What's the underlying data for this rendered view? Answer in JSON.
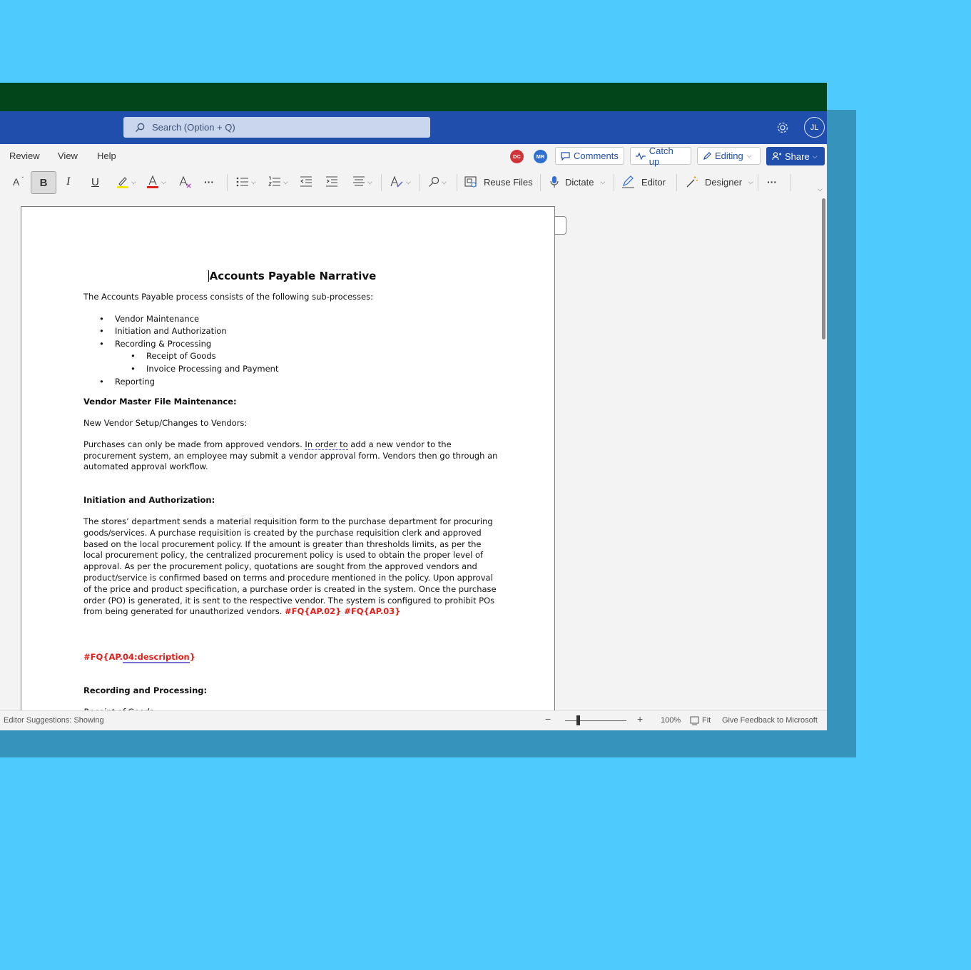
{
  "app": {
    "search_placeholder": "Search (Option + Q)",
    "user_initials": "JL"
  },
  "tabs": {
    "review": "Review",
    "view": "View",
    "help": "Help"
  },
  "presence": [
    {
      "initials": "DC",
      "color": "#d13438"
    },
    {
      "initials": "MR",
      "color": "#2f6fd1"
    }
  ],
  "ribbon_buttons": {
    "comments": "Comments",
    "catch_up": "Catch up",
    "editing": "Editing",
    "share": "Share"
  },
  "toolbar": {
    "font_size_icon": "A",
    "bold": "B",
    "italic": "I",
    "underline": "U",
    "more": "···",
    "reuse_files": "Reuse Files",
    "dictate": "Dictate",
    "editor": "Editor",
    "designer": "Designer"
  },
  "document": {
    "title": "Accounts Payable Narrative",
    "intro": "The Accounts Payable process consists of the following sub-processes:",
    "bullets": [
      "Vendor Maintenance",
      "Initiation and Authorization",
      "Recording & Processing"
    ],
    "sub_bullets": [
      "Receipt of Goods",
      "Invoice Processing and Payment"
    ],
    "last_bullet": "Reporting",
    "h_vendor": "Vendor Master File Maintenance:",
    "p_new_vendor": "New Vendor Setup/Changes to Vendors:",
    "p_purchases_a": "Purchases can only be made from approved vendors. ",
    "p_purchases_dashed": "In order to",
    "p_purchases_b": " add a new vendor to the procurement system, an employee may submit a vendor approval form. Vendors then go through an automated approval workflow.",
    "h_initiation": "Initiation and Authorization:",
    "p_stores": "The stores’ department sends a material requisition form to the purchase department for procuring goods/services.  A purchase requisition is created by the purchase requisition clerk and approved based on the local procurement policy.  If the amount is greater than thresholds limits, as per the local procurement policy, the centralized procurement policy is used to obtain the proper level of approval. As per the procurement policy, quotations are sought from the approved vendors and product/service is confirmed based on terms and procedure mentioned in the policy. Upon approval of the price and product specification, a purchase order is created in the system.  Once the purchase order (PO) is generated, it is sent to the respective vendor.  The system is configured to prohibit POs from being generated for unauthorized vendors.  ",
    "p_stores_tags": "#FQ{AP.02} #FQ{AP.03}",
    "tag_a": "#FQ{AP.",
    "tag_b": "04:description",
    "tag_c": "}",
    "h_recording": "Recording and Processing:",
    "p_receipt": "Receipt of Goods"
  },
  "status": {
    "editor_suggestions": "Editor Suggestions: Showing",
    "minus": "−",
    "plus": "+",
    "zoom": "100%",
    "fit": "Fit",
    "feedback": "Give Feedback to Microsoft"
  },
  "colors": {
    "title_bar": "#02451a",
    "command_bar": "#1f4eac",
    "background": "#4ecbfc",
    "tag_red": "#e0201b"
  }
}
